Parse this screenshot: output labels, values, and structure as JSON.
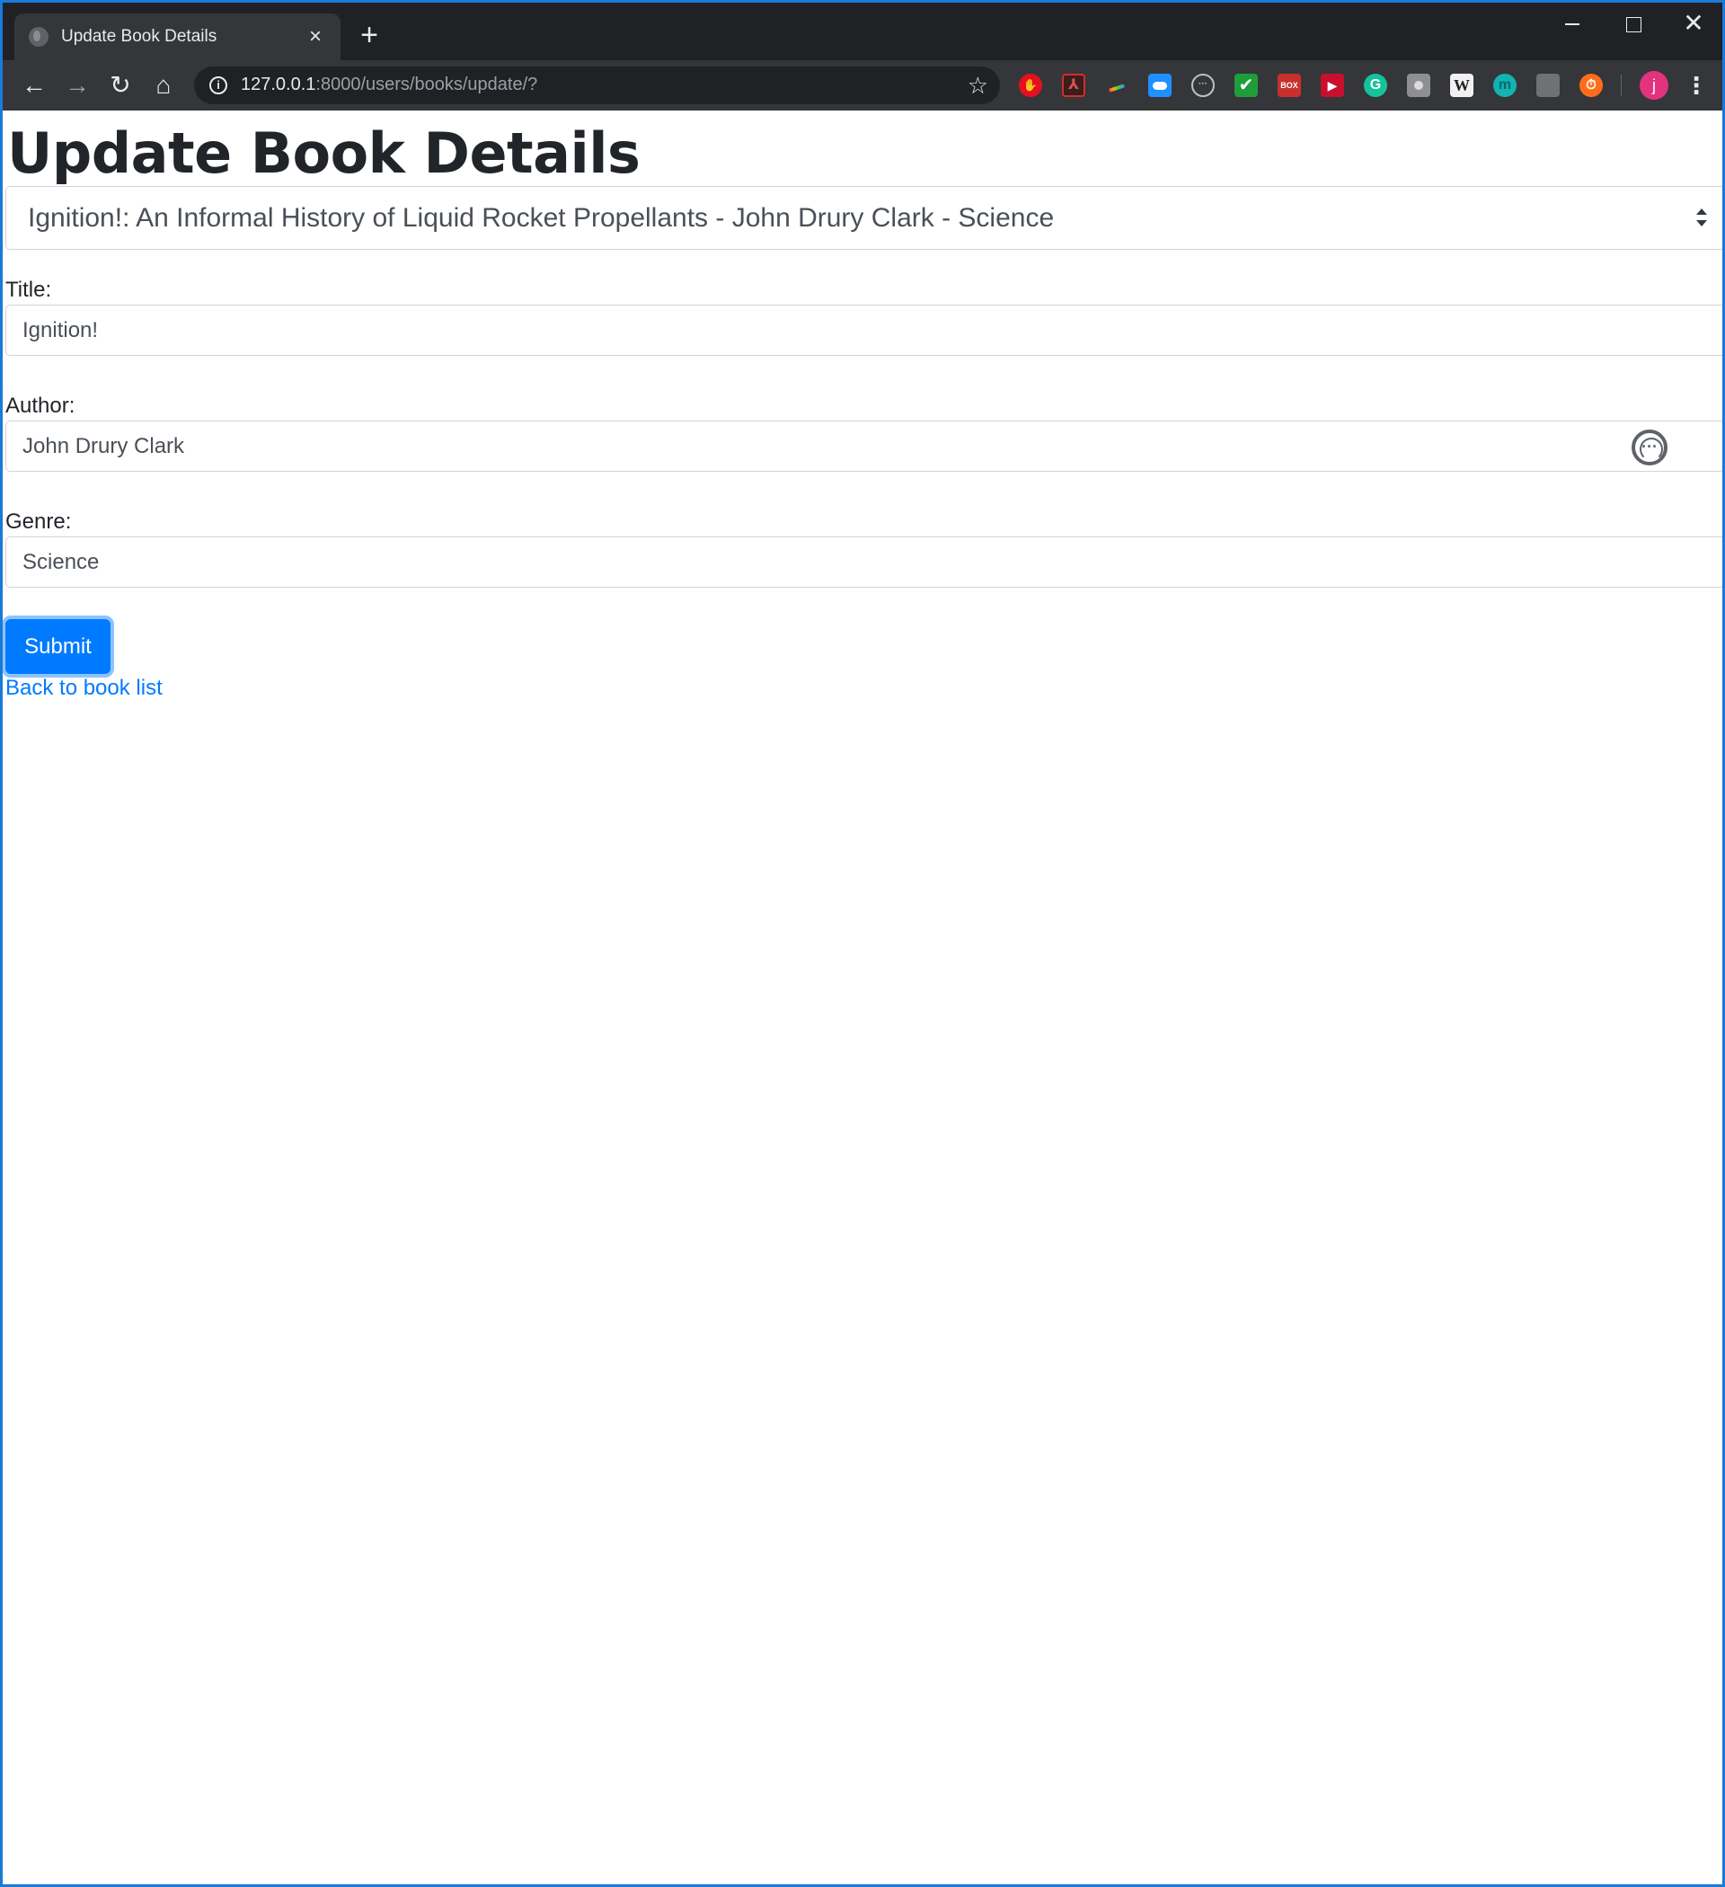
{
  "browser": {
    "tab_title": "Update Book Details",
    "tab_close": "×",
    "new_tab": "+",
    "url_host": "127.0.0.1",
    "url_rest": ":8000/users/books/update/?",
    "window_close": "✕",
    "nav": {
      "back": "←",
      "forward": "→",
      "reload": "↻",
      "home": "⌂"
    },
    "bookmark_star": "☆",
    "info_icon": "i",
    "menu": "⋮",
    "profile_initial": "j",
    "extensions": [
      {
        "name": "stop-icon",
        "glyph": "✋"
      },
      {
        "name": "pdf-icon",
        "glyph": "⅄"
      },
      {
        "name": "rainbow-icon",
        "glyph": ""
      },
      {
        "name": "cloud-icon",
        "glyph": ""
      },
      {
        "name": "ring-icon",
        "glyph": "···"
      },
      {
        "name": "check-icon",
        "glyph": "✔"
      },
      {
        "name": "red-box-icon",
        "glyph": "BOX"
      },
      {
        "name": "play-icon",
        "glyph": "▶"
      },
      {
        "name": "grammarly-icon",
        "glyph": "G"
      },
      {
        "name": "camera-icon",
        "glyph": ""
      },
      {
        "name": "wiki-icon",
        "glyph": "W"
      },
      {
        "name": "m-icon",
        "glyph": "m"
      },
      {
        "name": "chart-icon",
        "glyph": ""
      },
      {
        "name": "timer-icon",
        "glyph": "⏱"
      }
    ]
  },
  "page": {
    "title": "Update Book Details",
    "book_select_value": "Ignition!: An Informal History of Liquid Rocket Propellants - John Drury Clark - Science",
    "fields": {
      "title_label": "Title:",
      "title_value": "Ignition!",
      "author_label": "Author:",
      "author_value": "John Drury Clark",
      "genre_label": "Genre:",
      "genre_value": "Science"
    },
    "submit_label": "Submit",
    "back_link": "Back to book list"
  },
  "colors": {
    "primary": "#007bff",
    "window_border": "#1a7ad8",
    "chrome_dark": "#202124",
    "chrome_toolbar": "#35363a"
  }
}
